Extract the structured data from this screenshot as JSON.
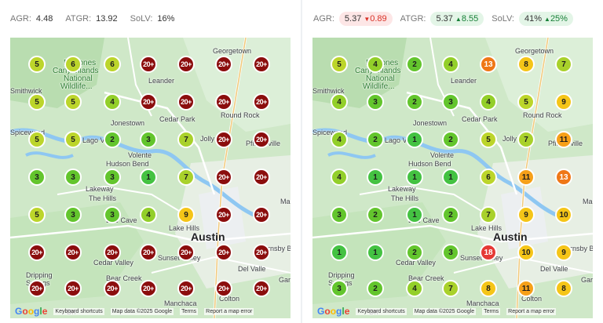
{
  "left": {
    "stats": [
      {
        "label": "AGR:",
        "value": "4.48"
      },
      {
        "label": "ATGR:",
        "value": "13.92"
      },
      {
        "label": "SoLV:",
        "value": "16%"
      }
    ]
  },
  "right": {
    "stats": [
      {
        "label": "AGR:",
        "value": "5.37",
        "delta": "0.89",
        "direction": "down",
        "chip": "red"
      },
      {
        "label": "ATGR:",
        "value": "5.37",
        "delta": "8.55",
        "direction": "up",
        "chip": "green"
      },
      {
        "label": "SoLV:",
        "value": "41%",
        "delta": "25%",
        "direction": "up",
        "chip": "green"
      }
    ]
  },
  "map_labels": {
    "georgetown": "Georgetown",
    "balcones": "Balcones",
    "canyonlands": "Canyonlands",
    "national": "National",
    "wildlife": "Wildlife...",
    "leander": "Leander",
    "smithwick": "Smithwick",
    "cedar_park": "Cedar Park",
    "round_rock": "Round Rock",
    "jonestown": "Jonestown",
    "spicewood": "Spicewood",
    "lago_vista": "Lago V",
    "volente": "Volente",
    "hudson_bend": "Hudson Bend",
    "jollyville": "Jolly",
    "pflugerville": "Pflugerville",
    "lakeway": "Lakeway",
    "the_hills": "The Hills",
    "bee_cave": "Bee Cave",
    "lake_hills": "Lake Hills",
    "austin": "Austin",
    "cedar_valley": "Cedar Valley",
    "sunset_valley": "Sunset Valley",
    "del_valle": "Del Valle",
    "dripping": "Dripping",
    "springs": "Springs",
    "bear_creek": "Bear Creek",
    "manchaca": "Manchaca",
    "colton": "Colton",
    "manor": "Ma",
    "hornsby": "rnsby Be",
    "garfield": "Gar",
    "dri": "Dri"
  },
  "map_footer": {
    "keyboard": "Keyboard shortcuts",
    "mapdata": "Map data ©2025 Google",
    "terms": "Terms",
    "report": "Report a map error"
  },
  "grids": {
    "left": [
      [
        "5",
        "6",
        "6",
        "20+",
        "20+",
        "20+",
        "20+"
      ],
      [
        "5",
        "5",
        "4",
        "20+",
        "20+",
        "20+",
        "20+"
      ],
      [
        "5",
        "5",
        "2",
        "3",
        "7",
        "20+",
        "20+"
      ],
      [
        "3",
        "3",
        "3",
        "1",
        "7",
        "20+",
        "20+"
      ],
      [
        "5",
        "3",
        "3",
        "4",
        "9",
        "20+",
        "20+"
      ],
      [
        "20+",
        "20+",
        "20+",
        "20+",
        "20+",
        "20+",
        "20+"
      ],
      [
        "20+",
        "20+",
        "20+",
        "20+",
        "20+",
        "20+",
        "20+"
      ]
    ],
    "right": [
      [
        "5",
        "4",
        "2",
        "4",
        "13",
        "8",
        "7"
      ],
      [
        "4",
        "3",
        "2",
        "3",
        "4",
        "5",
        "9"
      ],
      [
        "4",
        "2",
        "1",
        "2",
        "5",
        "7",
        "11"
      ],
      [
        "4",
        "1",
        "1",
        "1",
        "6",
        "11",
        "13"
      ],
      [
        "3",
        "2",
        "1",
        "2",
        "7",
        "9",
        "10"
      ],
      [
        "1",
        "1",
        "2",
        "3",
        "18",
        "10",
        "9"
      ],
      [
        "3",
        "2",
        "4",
        "7",
        "8",
        "11",
        "8"
      ]
    ]
  },
  "rank_colors": {
    "1": "#44c242",
    "2": "#63c52d",
    "3": "#63c52d",
    "4": "#93cf2a",
    "5": "#bcd52b",
    "6": "#bcd52b",
    "7": "#a9d12b",
    "8": "#f5c518",
    "9": "#f5c518",
    "10": "#f5c518",
    "11": "#f6a019",
    "13": "#ef7716",
    "18": "#e53935",
    "20+": "#8b0d0d"
  }
}
